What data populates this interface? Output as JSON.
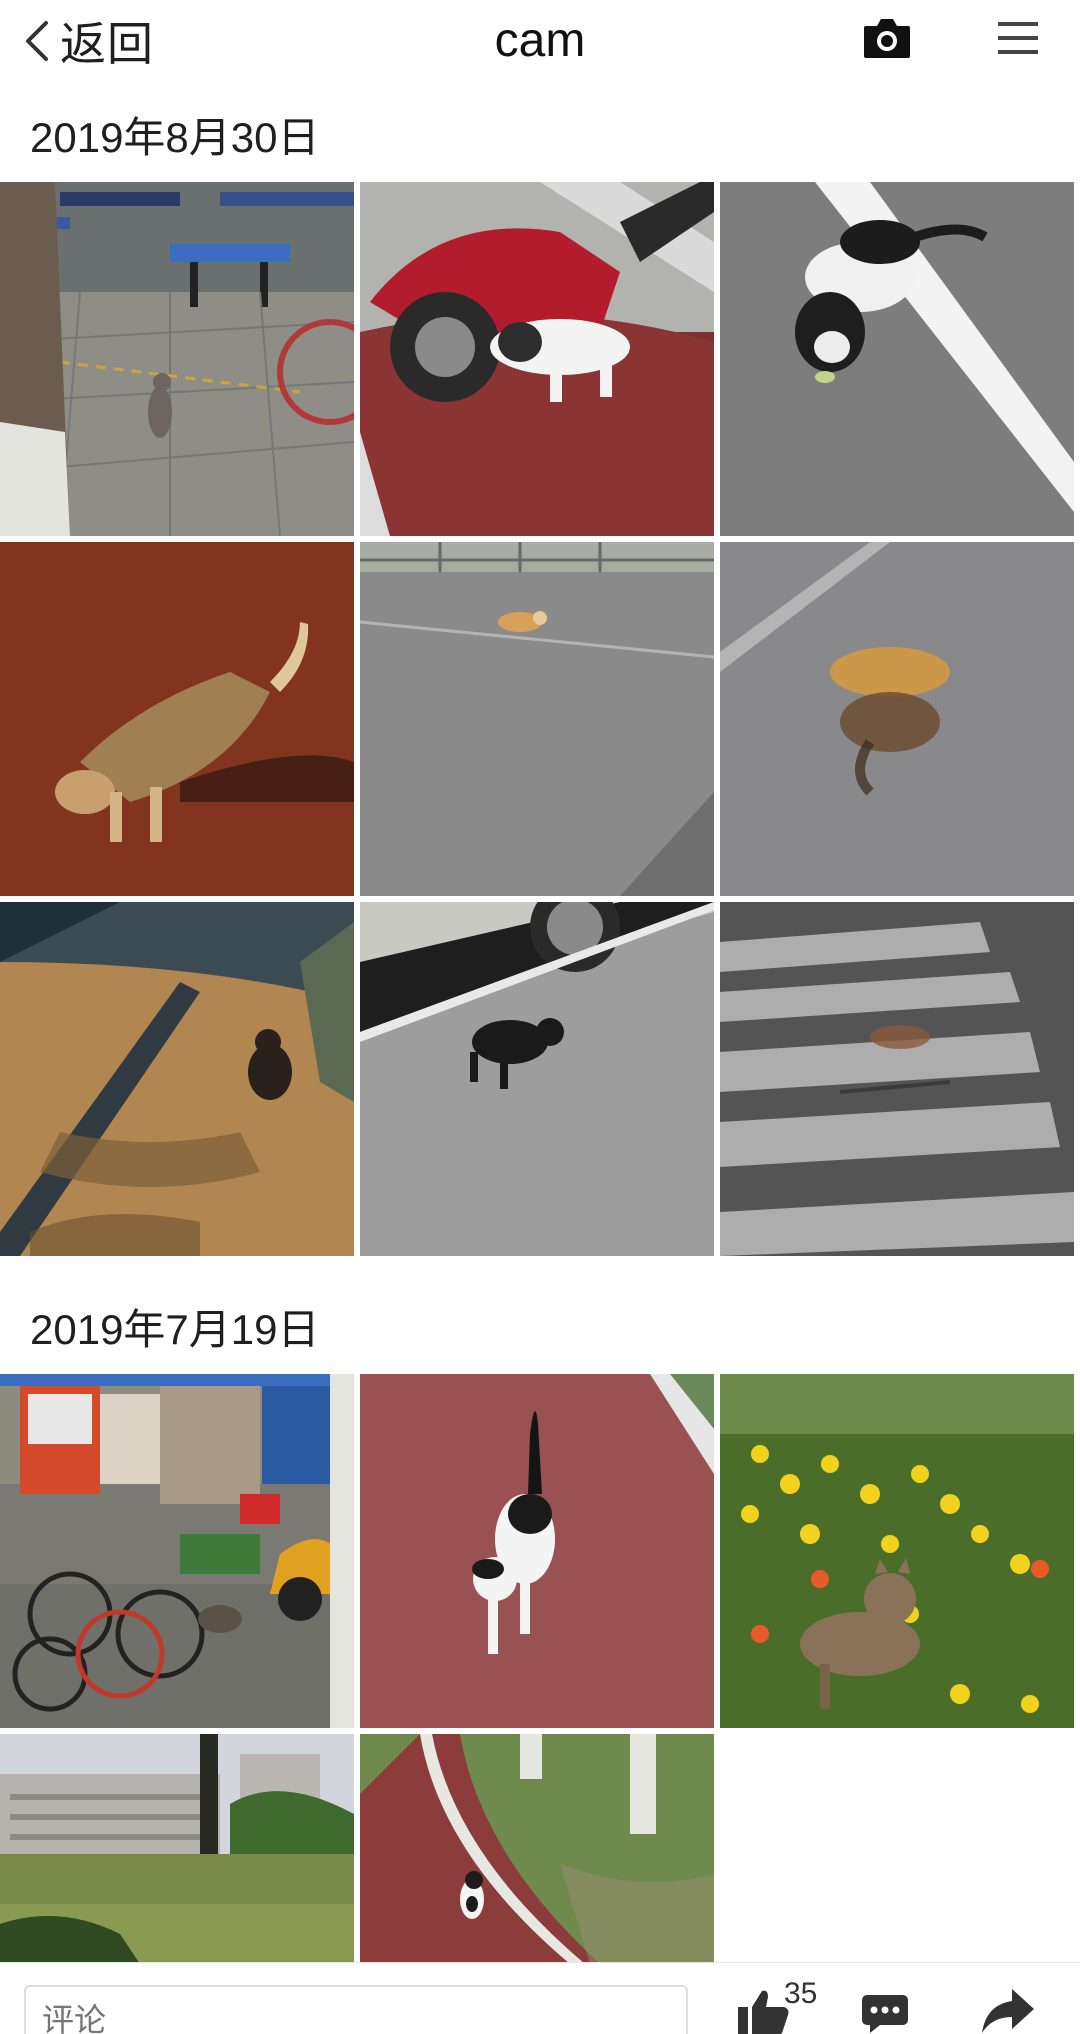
{
  "header": {
    "back_label": "返回",
    "title": "cam",
    "camera_icon": "camera-icon",
    "menu_icon": "hamburger-menu-icon"
  },
  "sections": [
    {
      "date": "2019年8月30日",
      "photos": [
        "cat-near-picnic-tables-photo",
        "cat-behind-red-scooter-photo",
        "black-white-cat-eating-photo",
        "cat-walking-on-red-ground-photo",
        "cat-lying-on-road-photo",
        "blurry-cat-on-road-photo",
        "dark-street-cat-photo",
        "black-cat-lying-near-car-photo",
        "blurry-cat-on-crosswalk-photo"
      ]
    },
    {
      "date": "2019年7月19日",
      "photos": [
        "bicycles-and-cat-photo",
        "black-white-cat-on-red-path-photo",
        "cat-in-flowers-photo",
        "campus-buildings-photo",
        "cat-on-red-path-with-trees-photo"
      ]
    }
  ],
  "bottom_bar": {
    "comment_placeholder": "评论",
    "like_count": "35",
    "like_icon": "thumbs-up-icon",
    "comment_icon": "comment-bubble-icon",
    "share_icon": "share-arrow-icon"
  }
}
